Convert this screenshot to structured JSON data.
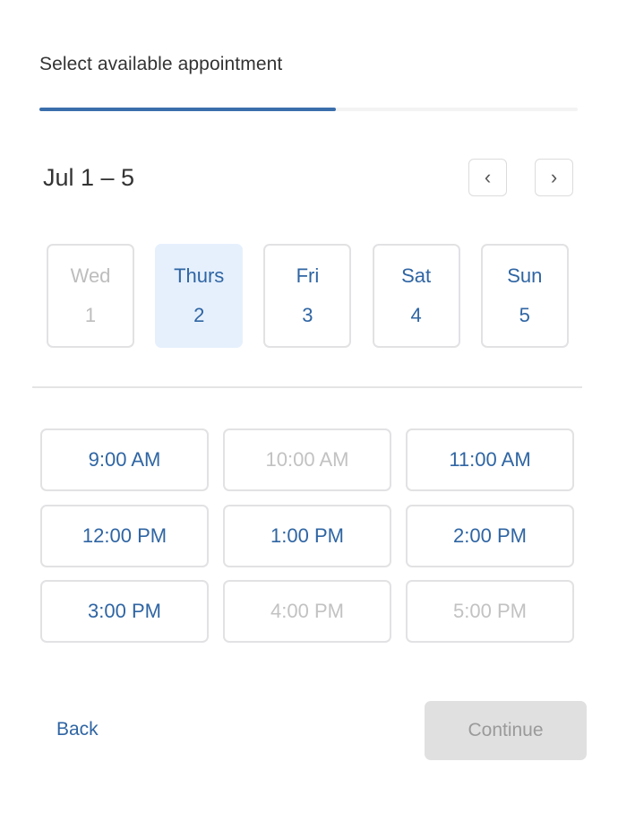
{
  "header": {
    "title": "Select available appointment",
    "progress_percent": 55
  },
  "calendar": {
    "range": "Jul 1 – 5",
    "prev_icon": "chevron-left-icon",
    "next_icon": "chevron-right-icon",
    "days": [
      {
        "name": "Wed",
        "date": "1",
        "state": "disabled"
      },
      {
        "name": "Thurs",
        "date": "2",
        "state": "selected"
      },
      {
        "name": "Fri",
        "date": "3",
        "state": "available"
      },
      {
        "name": "Sat",
        "date": "4",
        "state": "available"
      },
      {
        "name": "Sun",
        "date": "5",
        "state": "available"
      }
    ]
  },
  "slots": [
    {
      "label": "9:00 AM",
      "state": "available"
    },
    {
      "label": "10:00 AM",
      "state": "disabled"
    },
    {
      "label": "11:00 AM",
      "state": "available"
    },
    {
      "label": "12:00 PM",
      "state": "available"
    },
    {
      "label": "1:00 PM",
      "state": "available"
    },
    {
      "label": "2:00 PM",
      "state": "available"
    },
    {
      "label": "3:00 PM",
      "state": "available"
    },
    {
      "label": "4:00 PM",
      "state": "disabled"
    },
    {
      "label": "5:00 PM",
      "state": "disabled"
    }
  ],
  "footer": {
    "back_label": "Back",
    "continue_label": "Continue"
  },
  "colors": {
    "accent": "#2f65a3",
    "selected_bg": "#e6f0fd",
    "disabled_text": "#bdbdbd"
  }
}
